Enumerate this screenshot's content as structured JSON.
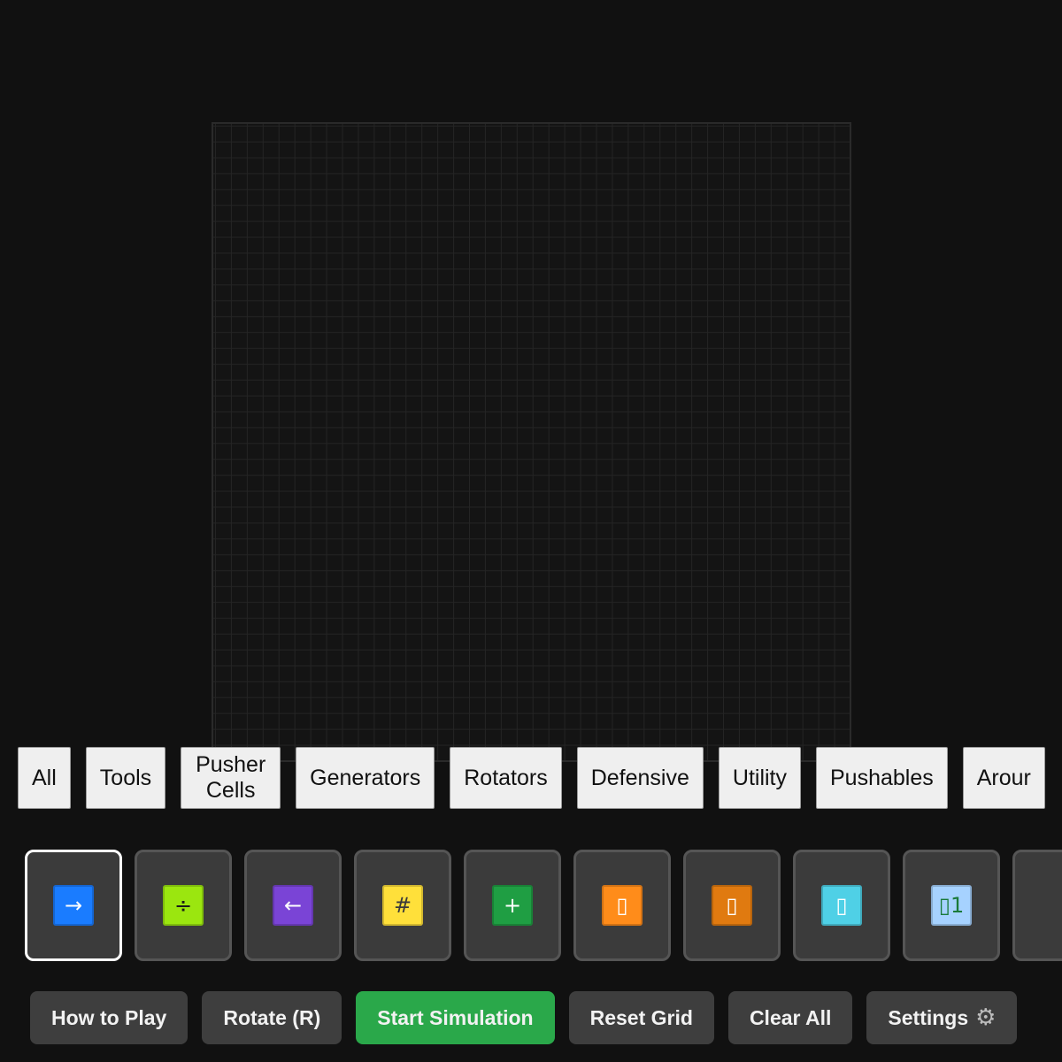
{
  "categories": [
    {
      "label": "All"
    },
    {
      "label": "Tools"
    },
    {
      "label": "Pusher Cells"
    },
    {
      "label": "Generators"
    },
    {
      "label": "Rotators"
    },
    {
      "label": "Defensive"
    },
    {
      "label": "Utility"
    },
    {
      "label": "Pushables"
    },
    {
      "label": "Arour"
    }
  ],
  "palette": [
    {
      "icon": "→",
      "color": "#1a7cff",
      "glyph_color": "#ffffff",
      "selected": true
    },
    {
      "icon": "÷",
      "color": "#9be60f",
      "glyph_color": "#1a1a1a"
    },
    {
      "icon": "←",
      "color": "#7a44d6",
      "glyph_color": "#ffffff"
    },
    {
      "icon": "#",
      "color": "#ffe03a",
      "glyph_color": "#3a3a3a"
    },
    {
      "icon": "+",
      "color": "#1f9e43",
      "glyph_color": "#ffffff"
    },
    {
      "icon": "▯",
      "color": "#ff8c1a",
      "glyph_color": "#ffffff"
    },
    {
      "icon": "▯",
      "color": "#e07a10",
      "glyph_color": "#ffffff"
    },
    {
      "icon": "▯",
      "color": "#4fd0e6",
      "glyph_color": "#ffffff"
    },
    {
      "icon": "▯1",
      "color": "#a6d2ff",
      "glyph_color": "#1a7a3a"
    },
    {
      "icon": "",
      "color": "#9aa040",
      "glyph_color": "#ffffff"
    }
  ],
  "actions": {
    "how_to_play": "How to Play",
    "rotate": "Rotate (R)",
    "start": "Start Simulation",
    "reset": "Reset Grid",
    "clear": "Clear All",
    "settings": "Settings",
    "settings_icon": "⚙"
  },
  "colors": {
    "background": "#111111",
    "start_button": "#2aa84a",
    "button": "#3e3e3e"
  }
}
